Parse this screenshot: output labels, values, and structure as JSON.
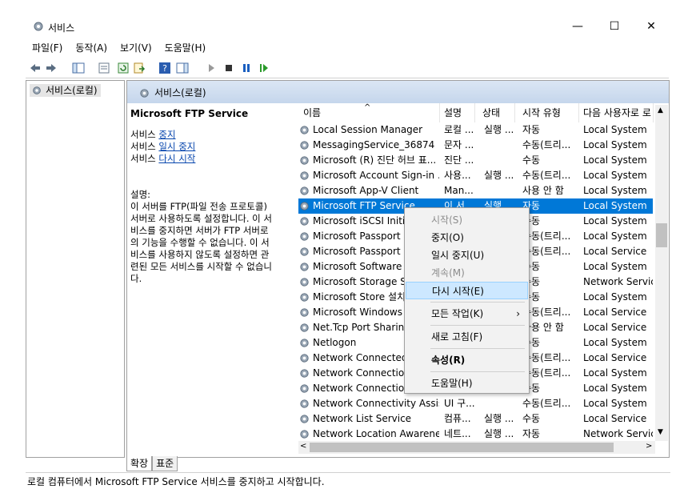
{
  "window": {
    "title": "서비스",
    "controls": [
      "—",
      "☐",
      "✕"
    ]
  },
  "menu": [
    "파일(F)",
    "동작(A)",
    "보기(V)",
    "도움말(H)"
  ],
  "tree": {
    "root_label": "서비스(로컬)"
  },
  "pane": {
    "header": "서비스(로컬)"
  },
  "detail": {
    "service_name": "Microsoft FTP Service",
    "action_prefix": "서비스",
    "actions": [
      "중지",
      "일시 중지",
      "다시 시작"
    ],
    "desc_label": "설명:",
    "desc_lines": [
      "이 서버를 FTP(파일 전송 프로토콜)",
      "서버로 사용하도록 설정합니다. 이 서",
      "비스를 중지하면 서버가 FTP 서버로",
      "의 기능을 수행할 수 없습니다. 이 서",
      "비스를 사용하지 않도록 설정하면 관",
      "련된 모든 서비스를 시작할 수 없습니",
      "다."
    ]
  },
  "columns": [
    "이름",
    "설명",
    "상태",
    "시작 유형",
    "다음 사용자로 로"
  ],
  "rows": [
    {
      "name": "Local Session Manager",
      "desc": "로컬 ...",
      "status": "실행 ...",
      "start": "자동",
      "logon": "Local System"
    },
    {
      "name": "MessagingService_36874",
      "desc": "문자 ...",
      "status": "",
      "start": "수동(트리...",
      "logon": "Local System"
    },
    {
      "name": "Microsoft (R) 진단 허브 표...",
      "desc": "진단 ...",
      "status": "",
      "start": "수동",
      "logon": "Local System"
    },
    {
      "name": "Microsoft Account Sign-in ...",
      "desc": "사용...",
      "status": "실행 ...",
      "start": "수동(트리...",
      "logon": "Local System"
    },
    {
      "name": "Microsoft App-V Client",
      "desc": "Man...",
      "status": "",
      "start": "사용 안 함",
      "logon": "Local System"
    },
    {
      "name": "Microsoft FTP Service",
      "desc": "이 서...",
      "status": "실행 ...",
      "start": "자동",
      "logon": "Local System"
    },
    {
      "name": "Microsoft iSCSI Initiator...",
      "desc": "",
      "status": "",
      "start": "수동",
      "logon": "Local System"
    },
    {
      "name": "Microsoft Passport",
      "desc": "",
      "status": "",
      "start": "수동(트리...",
      "logon": "Local System"
    },
    {
      "name": "Microsoft Passport Container",
      "desc": "",
      "status": "",
      "start": "수동(트리...",
      "logon": "Local Service"
    },
    {
      "name": "Microsoft Software Shadow...",
      "desc": "",
      "status": "",
      "start": "수동",
      "logon": "Local System"
    },
    {
      "name": "Microsoft Storage Spaces...",
      "desc": "",
      "status": "",
      "start": "수동",
      "logon": "Network Service"
    },
    {
      "name": "Microsoft Store 설치 서비스",
      "desc": "",
      "status": "",
      "start": "수동",
      "logon": "Local System"
    },
    {
      "name": "Microsoft Windows SMS...",
      "desc": "",
      "status": "",
      "start": "수동(트리...",
      "logon": "Local Service"
    },
    {
      "name": "Net.Tcp Port Sharing Service",
      "desc": "",
      "status": "",
      "start": "사용 안 함",
      "logon": "Local Service"
    },
    {
      "name": "Netlogon",
      "desc": "",
      "status": "",
      "start": "수동",
      "logon": "Local System"
    },
    {
      "name": "Network Connected Devices...",
      "desc": "",
      "status": "",
      "start": "수동(트리...",
      "logon": "Local Service"
    },
    {
      "name": "Network Connection Broker",
      "desc": "",
      "status": "",
      "start": "수동(트리...",
      "logon": "Local System"
    },
    {
      "name": "Network Connections",
      "desc": "",
      "status": "",
      "start": "수동",
      "logon": "Local System"
    },
    {
      "name": "Network Connectivity Assis...",
      "desc": "UI 구...",
      "status": "",
      "start": "수동(트리...",
      "logon": "Local System"
    },
    {
      "name": "Network List Service",
      "desc": "컴퓨...",
      "status": "실행 ...",
      "start": "수동",
      "logon": "Local Service"
    },
    {
      "name": "Network Location Awareness",
      "desc": "네트...",
      "status": "실행 ...",
      "start": "자동",
      "logon": "Network Service"
    }
  ],
  "selected_row": 5,
  "context_menu": [
    {
      "label": "시작(S)",
      "state": "disabled"
    },
    {
      "label": "중지(O)",
      "state": "normal"
    },
    {
      "label": "일시 중지(U)",
      "state": "normal"
    },
    {
      "label": "계속(M)",
      "state": "disabled"
    },
    {
      "label": "다시 시작(E)",
      "state": "highlighted"
    },
    {
      "label": "모든 작업(K)",
      "state": "normal",
      "submenu": true
    },
    {
      "label": "새로 고침(F)",
      "state": "normal"
    },
    {
      "label": "속성(R)",
      "state": "bold"
    },
    {
      "label": "도움말(H)",
      "state": "normal"
    }
  ],
  "tabs": [
    "확장",
    "표준"
  ],
  "status_text": "로컬 컴퓨터에서 Microsoft FTP Service 서비스를 중지하고 시작합니다.",
  "colors": {
    "selection": "#0078d7",
    "menu_highlight": "#cde8ff",
    "link": "#0645ad"
  }
}
